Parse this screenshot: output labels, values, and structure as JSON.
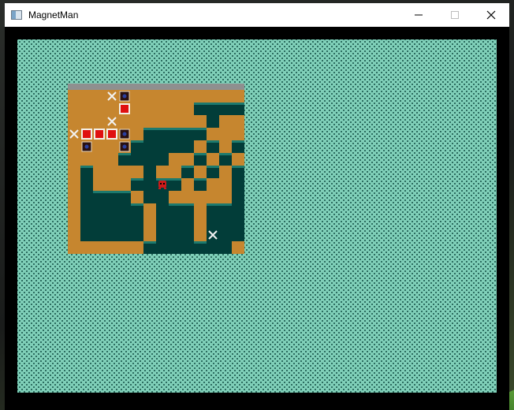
{
  "window": {
    "title": "MagnetMan",
    "icon": "app-window-icon",
    "controls": [
      "minimize-icon",
      "maximize-icon",
      "close-icon"
    ]
  },
  "colors": {
    "background": "#7fcfb8",
    "floor": "#c6862f",
    "wall": "#023d39",
    "wall_edge": "#1d7a6e",
    "top_border": "#8f8f8f",
    "magnet_red": "#e01010",
    "player": "#cc1a1a",
    "target": "#f2f2f2"
  },
  "level": {
    "tiles": [
      "..............",
      "..........####",
      "...........#..",
      "......#####...",
      ".....#####.#.#",
      "....####..#.#.",
      ".#....#..#.#.#",
      ".#...####.#..#",
      ".####.##.....#",
      ".#####.###.###",
      ".#####.###.###",
      ".#####.###.###",
      "......#######.",
      ".............."
    ],
    "magnets": [
      {
        "row": 1,
        "col": 4
      },
      {
        "row": 3,
        "col": 1
      },
      {
        "row": 3,
        "col": 2
      },
      {
        "row": 3,
        "col": 3
      }
    ],
    "sockets": [
      {
        "row": 0,
        "col": 4
      },
      {
        "row": 3,
        "col": 4
      },
      {
        "row": 4,
        "col": 1
      },
      {
        "row": 4,
        "col": 4
      }
    ],
    "targets": [
      {
        "row": 0,
        "col": 3
      },
      {
        "row": 2,
        "col": 3
      },
      {
        "row": 3,
        "col": 0
      },
      {
        "row": 11,
        "col": 11
      }
    ],
    "player": {
      "row": 7,
      "col": 7
    }
  }
}
